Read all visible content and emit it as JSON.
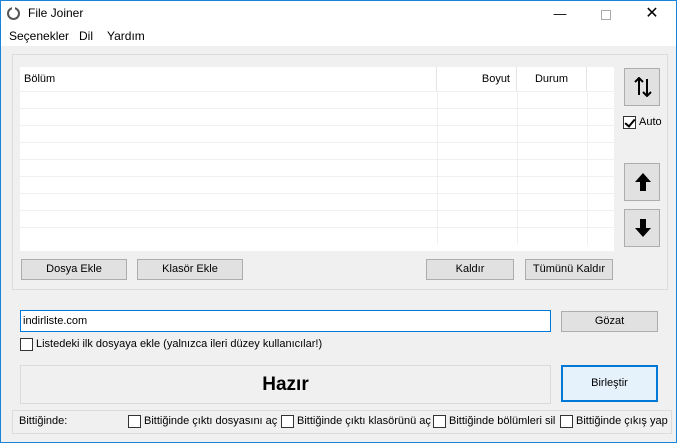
{
  "window": {
    "title": "File Joiner",
    "minimize_glyph": "—",
    "close_glyph": "✕",
    "icon": "app-logo-icon"
  },
  "menu": {
    "items": [
      "Seçenekler",
      "Dil",
      "Yardım"
    ]
  },
  "list": {
    "columns": {
      "name": "Bölüm",
      "size": "Boyut",
      "status": "Durum"
    },
    "rows": []
  },
  "side_controls": {
    "auto_label": "Auto",
    "auto_checked": true,
    "sort_icon": "sort-arrows-icon",
    "up_icon": "arrow-up-icon",
    "down_icon": "arrow-down-icon"
  },
  "buttons": {
    "add_file": "Dosya Ekle",
    "add_folder": "Klasör Ekle",
    "remove": "Kaldır",
    "remove_all": "Tümünü Kaldır",
    "browse": "Gözat",
    "merge": "Birleştir"
  },
  "output": {
    "path_value": "indirliste.com",
    "first_file_label": "Listedeki ilk dosyaya ekle (yalnızca ileri düzey kullanıcılar!)",
    "first_file_checked": false
  },
  "status": {
    "text": "Hazır"
  },
  "on_finish": {
    "label": "Bittiğinde:",
    "options": [
      {
        "label": "Bittiğinde çıktı dosyasını aç",
        "checked": false
      },
      {
        "label": "Bittiğinde çıktı klasörünü aç",
        "checked": false
      },
      {
        "label": "Bittiğinde bölümleri sil",
        "checked": false
      },
      {
        "label": "Bittiğinde çıkış yap",
        "checked": false
      }
    ]
  },
  "colors": {
    "accent": "#0078d7",
    "window_border": "#1883d7",
    "button_face": "#e1e1e1"
  }
}
